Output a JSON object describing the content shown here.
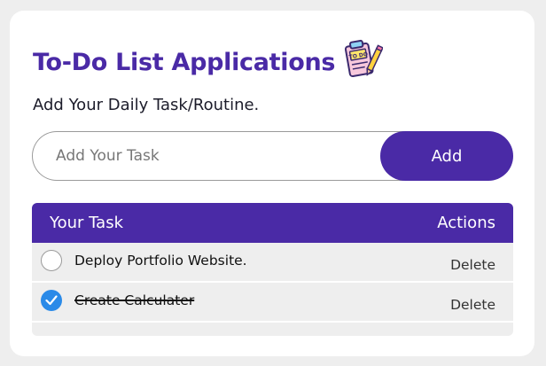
{
  "header": {
    "title": "To-Do List Applications",
    "subtitle": "Add Your Daily Task/Routine."
  },
  "task_form": {
    "input_value": "",
    "input_placeholder": "Add Your Task",
    "add_label": "Add"
  },
  "task_list": {
    "column_task": "Your Task",
    "column_actions": "Actions",
    "items": [
      {
        "text": "Deploy Portfolio Website.",
        "completed": false,
        "action_label": "Delete"
      },
      {
        "text": "Create Calculater",
        "completed": true,
        "action_label": "Delete"
      }
    ]
  },
  "colors": {
    "accent": "#4a2aa6",
    "check": "#2a8ae8",
    "list_bg": "#eeeeee"
  },
  "icons": [
    "todo-clipboard-icon",
    "check-icon"
  ]
}
